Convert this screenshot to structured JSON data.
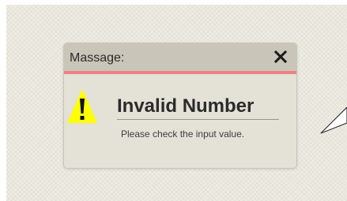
{
  "dialog": {
    "title": "Massage:",
    "heading": "Invalid Number",
    "message": "Please check the input value."
  },
  "icons": {
    "close": "close-icon",
    "warning": "warning-icon"
  },
  "colors": {
    "background": "#eeebe3",
    "dialog_body": "#e4e1d7",
    "title_bar": "#c9c5b8",
    "accent_line": "#ef8181",
    "warning_fill": "#ffff00"
  }
}
